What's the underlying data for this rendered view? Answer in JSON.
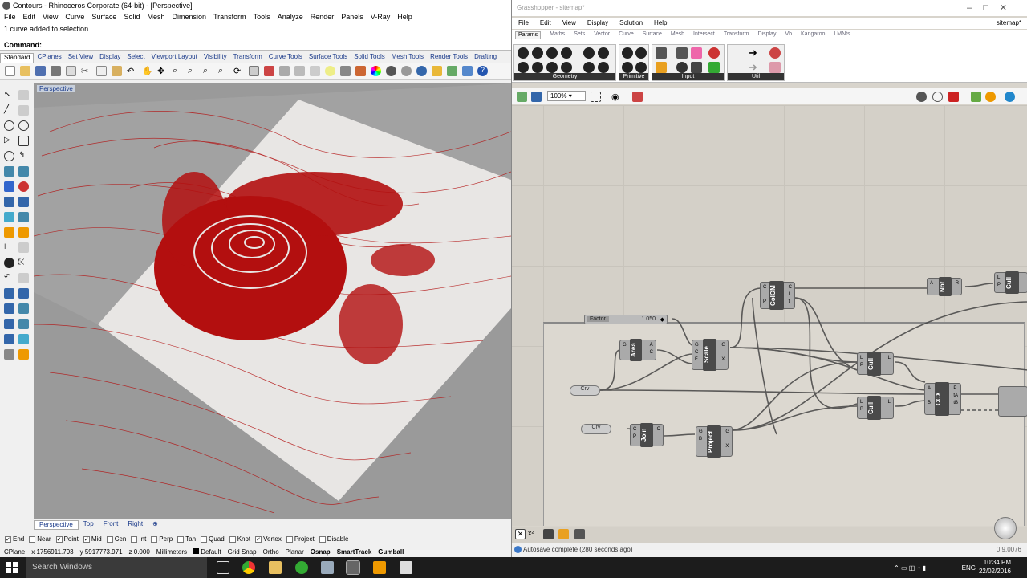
{
  "rhino": {
    "title": "Contours - Rhinoceros Corporate (64-bit) - [Perspective]",
    "menu": [
      "File",
      "Edit",
      "View",
      "Curve",
      "Surface",
      "Solid",
      "Mesh",
      "Dimension",
      "Transform",
      "Tools",
      "Analyze",
      "Render",
      "Panels",
      "V-Ray",
      "Help"
    ],
    "command_history": "1 curve added to selection.",
    "command_label": "Command:",
    "toolbar_tabs": [
      "Standard",
      "CPlanes",
      "Set View",
      "Display",
      "Select",
      "Viewport Layout",
      "Visibility",
      "Transform",
      "Curve Tools",
      "Surface Tools",
      "Solid Tools",
      "Mesh Tools",
      "Render Tools",
      "Drafting"
    ],
    "viewport_label": "Perspective",
    "viewport_tabs": [
      "Perspective",
      "Top",
      "Front",
      "Right"
    ],
    "osnaps": [
      {
        "label": "End",
        "checked": true
      },
      {
        "label": "Near",
        "checked": false
      },
      {
        "label": "Point",
        "checked": true
      },
      {
        "label": "Mid",
        "checked": true
      },
      {
        "label": "Cen",
        "checked": false
      },
      {
        "label": "Int",
        "checked": false
      },
      {
        "label": "Perp",
        "checked": false
      },
      {
        "label": "Tan",
        "checked": false
      },
      {
        "label": "Quad",
        "checked": false
      },
      {
        "label": "Knot",
        "checked": false
      },
      {
        "label": "Vertex",
        "checked": true
      },
      {
        "label": "Project",
        "checked": false
      },
      {
        "label": "Disable",
        "checked": false
      }
    ],
    "status": {
      "cplane": "CPlane",
      "x": "x 1756911.793",
      "y": "y 5917773.971",
      "z": "z 0.000",
      "units": "Millimeters",
      "layer": "Default",
      "grid_snap": "Grid Snap",
      "ortho": "Ortho",
      "planar": "Planar",
      "osnap": "Osnap",
      "smarttrack": "SmartTrack",
      "gumball": "Gumball"
    }
  },
  "grasshopper": {
    "title": "Grasshopper - sitemap*",
    "doc_name": "sitemap*",
    "menu": [
      "File",
      "Edit",
      "View",
      "Display",
      "Solution",
      "Help"
    ],
    "tabs": [
      "Params",
      "Maths",
      "Sets",
      "Vector",
      "Curve",
      "Surface",
      "Mesh",
      "Intersect",
      "Transform",
      "Display",
      "Vb",
      "Kangaroo",
      "LMNts"
    ],
    "ribbon_groups": [
      "Geometry",
      "Primitive",
      "Input",
      "Util"
    ],
    "zoom": "100%",
    "slider": {
      "label": "Factor",
      "value": "1.050"
    },
    "components": {
      "area": "Area",
      "scale": "Scale",
      "colm": "CoIOM",
      "not": "Not",
      "cull1": "Cull",
      "cull2": "Cull",
      "cull3": "Cull",
      "ccx": "CCX",
      "join": "Join",
      "project": "Project",
      "crv1": "Crv",
      "crv2": "Crv"
    },
    "status": "Autosave complete (280 seconds ago)",
    "version": "0.9.0076"
  },
  "taskbar": {
    "search": "Search Windows",
    "lang": "ENG",
    "time": "10:34 PM",
    "date": "22/02/2016"
  }
}
